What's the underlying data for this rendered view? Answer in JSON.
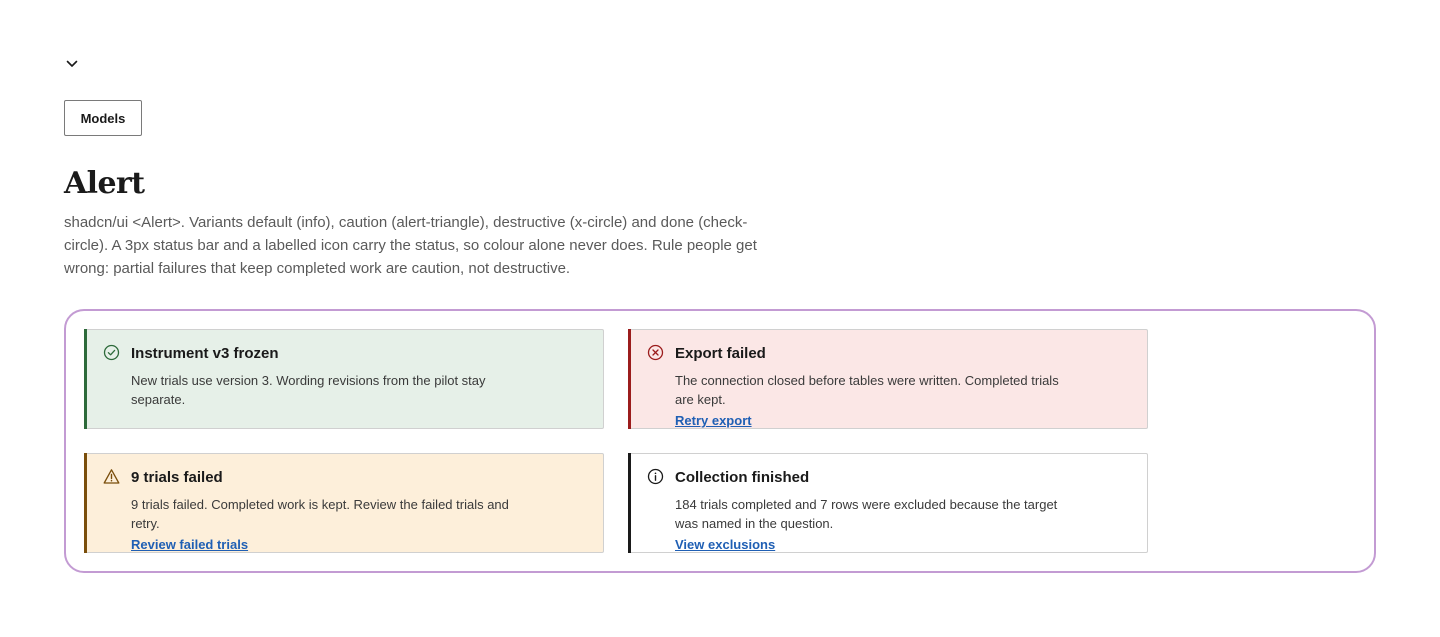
{
  "page": {
    "title": "Alert",
    "description": "shadcn/ui <Alert>. Variants default (info), caution (alert-triangle), destructive (x-circle) and done (check-circle). A 3px status bar and a labelled icon carry the status, so colour alone never does. Rule people get wrong: partial failures that keep completed work are caution, not destructive."
  },
  "toolbar": {
    "collapse_icon": "chevron-down-icon",
    "models_label": "Models"
  },
  "alerts": [
    {
      "variant": "done",
      "icon": "check-circle-icon",
      "title": "Instrument v3 frozen",
      "description": "New trials use version 3. Wording revisions from the pilot stay separate.",
      "link": ""
    },
    {
      "variant": "destructive",
      "icon": "x-circle-icon",
      "title": "Export failed",
      "description": "The connection closed before tables were written. Completed trials are kept.",
      "link": "Retry export"
    },
    {
      "variant": "caution",
      "icon": "alert-triangle-icon",
      "title": "9 trials failed",
      "description": "9 trials failed. Completed work is kept. Review the failed trials and retry.",
      "link": "Review failed trials"
    },
    {
      "variant": "default",
      "icon": "info-icon",
      "title": "Collection finished",
      "description": "184 trials completed and 7 rows were excluded because the target was named in the question.",
      "link": "View exclusions"
    }
  ],
  "colors": {
    "done_bar": "#2d6a3a",
    "destructive_bar": "#9b1c1c",
    "caution_bar": "#7a4e0b",
    "info_bar": "#1a1a1a",
    "link": "#1f5fb4",
    "frame_border": "#c39bd3"
  }
}
